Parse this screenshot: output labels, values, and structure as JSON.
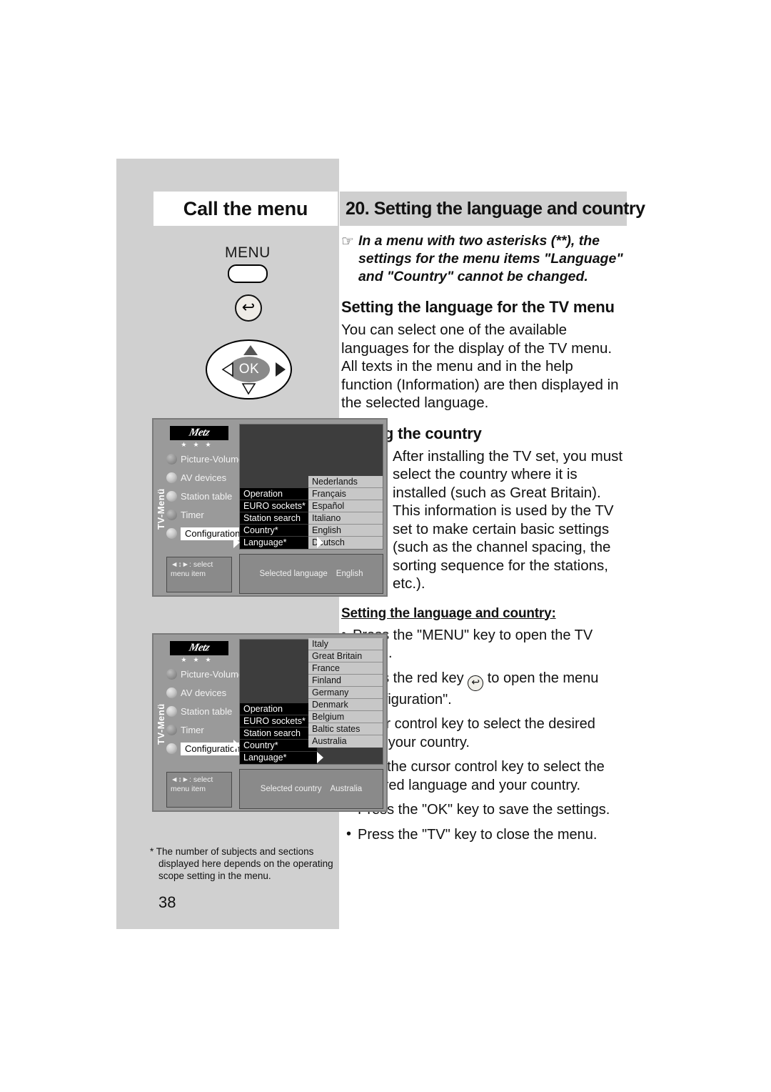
{
  "header": {
    "left_title": "Call the menu",
    "right_title": "20. Setting the language and country"
  },
  "remote": {
    "menu_label": "MENU",
    "red_key_glyph": "↩",
    "ok_label": "OK"
  },
  "note": {
    "hand_icon": "☞",
    "text": "In a menu with two asterisks (**), the settings for the menu items \"Language\" and \"Country\" cannot be changed."
  },
  "sections": {
    "lang_heading": "Setting the language for the TV menu",
    "lang_body": "You can select one of the available languages for the display of the TV menu. All texts in the menu and in the help function (Information) are then displayed in the selected language.",
    "country_heading": "Setting the country",
    "country_body": "After installing the TV set, you must select the country where it is installed (such as Great Britain). This information is used by the TV set to make certain basic settings (such as the channel spacing, the sorting sequence for the stations, etc.).",
    "steps_heading": "Setting the language and country:"
  },
  "steps": {
    "s1": "Press the \"MENU\" key to open the TV menu.",
    "s2a": "Press the red key",
    "s2b": "to open the menu \"Configuration\".",
    "s3": "Use the cursor control key to select the desired language and your country.",
    "s4": "Use the cursor control key to select the desired language and your country.",
    "s5": "Press the \"OK\" key to save the settings.",
    "s6": "Press the \"TV\" key to close the menu."
  },
  "tv_menu_1": {
    "vertical_label": "TV-Menü",
    "logo_word": "Metz",
    "stars": "★★★",
    "side_items": [
      "Picture-Volume",
      "AV devices",
      "Station table",
      "Timer",
      "Configuration"
    ],
    "selected_side_item": "Configuration",
    "hint_line1": "◄↕►: select",
    "hint_line2": "menu item",
    "menu_items": [
      "Operation",
      "EURO sockets*",
      "Station search",
      "Country*",
      "Language*"
    ],
    "list_items": [
      "Nederlands",
      "Français",
      "Español",
      "Italiano",
      "English",
      "Deutsch"
    ],
    "status_label": "Selected language",
    "status_value": "English"
  },
  "tv_menu_2": {
    "vertical_label": "TV-Menü",
    "logo_word": "Metz",
    "stars": "★★★",
    "side_items": [
      "Picture-Volume",
      "AV devices",
      "Station table",
      "Timer",
      "Configuration"
    ],
    "selected_side_item": "Configuration",
    "hint_line1": "◄↕►: select",
    "hint_line2": "menu item",
    "menu_items": [
      "Operation",
      "EURO sockets*",
      "Station search",
      "Country*",
      "Language*"
    ],
    "list_items": [
      "Italy",
      "Great Britain",
      "France",
      "Finland",
      "Germany",
      "Denmark",
      "Belgium",
      "Baltic states",
      "Australia"
    ],
    "status_label": "Selected country",
    "status_value": "Australia"
  },
  "footnote": "* The number of subjects and sections displayed here depends on the operating scope setting in the menu.",
  "page_number": "38"
}
